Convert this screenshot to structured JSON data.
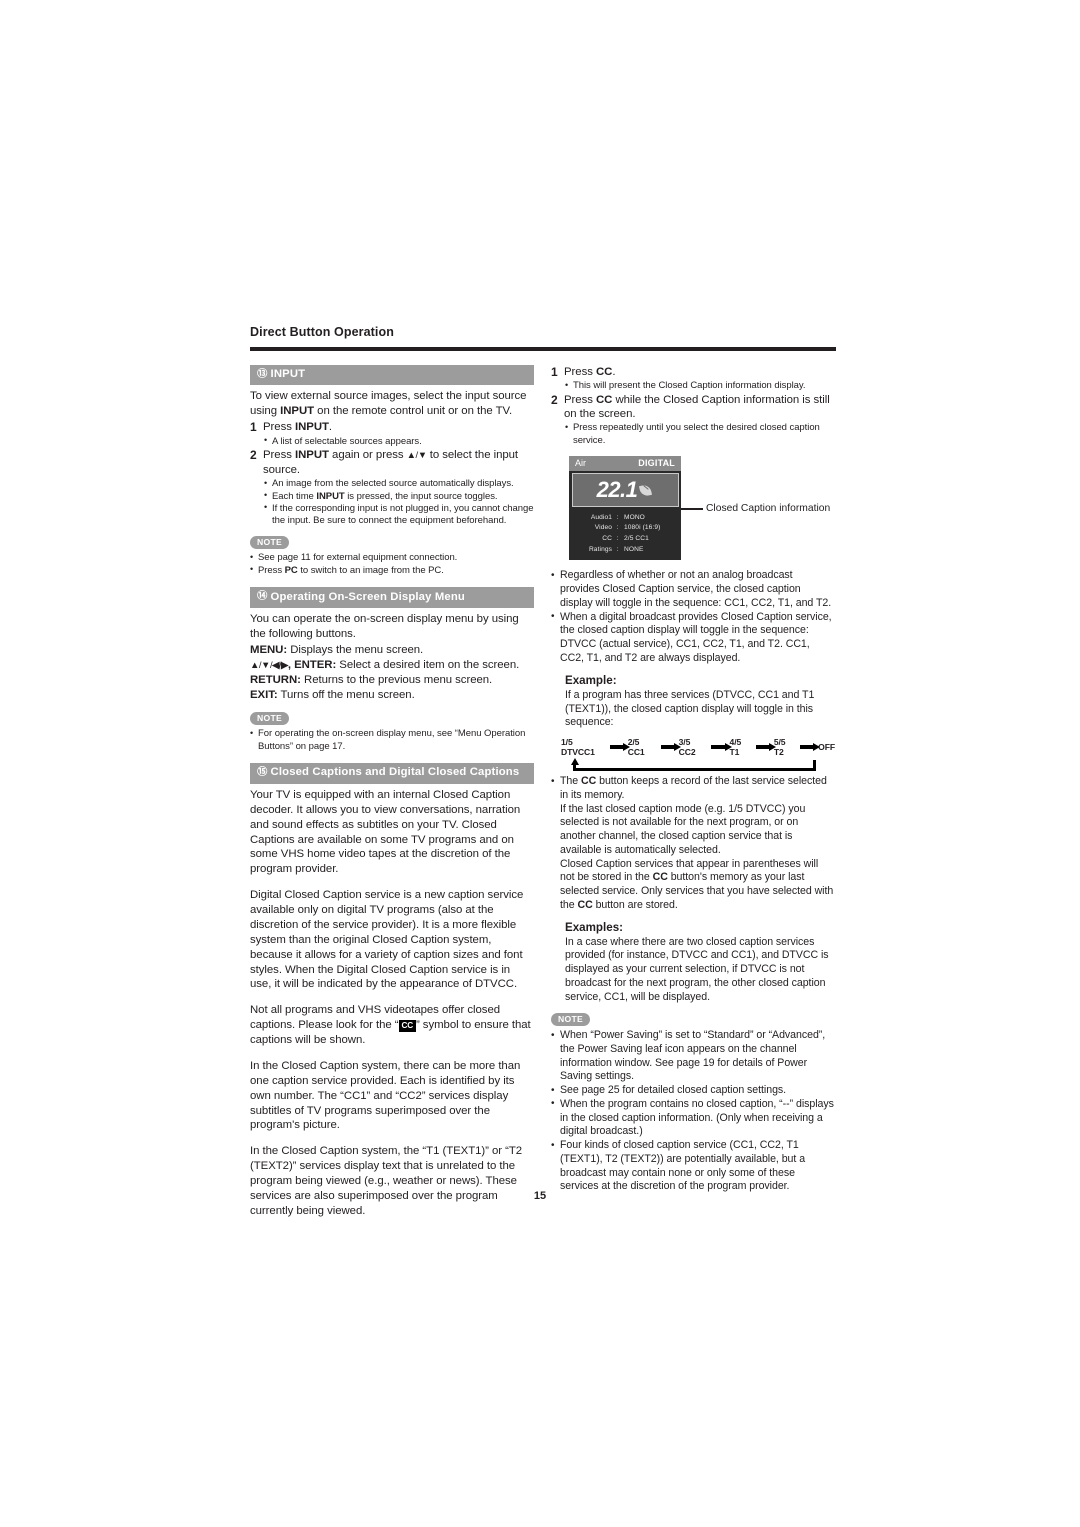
{
  "running_head": "Direct Button Operation",
  "page_number": "15",
  "left_column": {
    "section_input": {
      "number": "⑬",
      "title": "INPUT",
      "intro": "To view external source images, select the input source using <b>INPUT</b> on the remote control unit or on the TV.",
      "steps": [
        {
          "num": "1",
          "text": "Press <b>INPUT</b>.",
          "bullets": [
            "A list of selectable sources appears."
          ]
        },
        {
          "num": "2",
          "text": "Press <b>INPUT</b> again or press <span class=\"arrowglyph\"><b>▲</b>/<b>▼</b></span> to select the input source.",
          "bullets": [
            "An image from the selected source automatically displays.",
            "Each time <b>INPUT</b> is pressed, the input source toggles.",
            "If the corresponding input is not plugged in, you cannot change the input. Be sure to connect the equipment beforehand."
          ]
        }
      ],
      "note_label": "NOTE",
      "notes": [
        "See page 11 for external equipment connection.",
        "Press <b>PC</b> to switch to an image from the PC."
      ]
    },
    "section_osd": {
      "number": "⑭",
      "title": "Operating On-Screen Display Menu",
      "intro": "You can operate the on-screen display menu by using the following buttons.",
      "keys": [
        "<b>MENU:</b> Displays the menu screen.",
        "<span class=\"arrowglyph\"><b>▲</b>/<b>▼</b>/<b>◀</b>/<b>▶</b></span><b>, ENTER:</b> Select a desired item on the screen.",
        "<b>RETURN:</b> Returns to the previous menu screen.",
        "<b>EXIT:</b> Turns off the menu screen."
      ],
      "note_label": "NOTE",
      "notes": [
        "For operating the on-screen display menu, see “Menu Operation Buttons” on page 17."
      ]
    },
    "section_cc": {
      "number": "⑮",
      "title": "Closed Captions and Digital Closed Captions",
      "paragraphs": [
        "Your TV is equipped with an internal Closed Caption decoder. It allows you to view conversations, narration and sound effects as subtitles on your TV. Closed Captions are available on some TV programs and on some VHS home video tapes at the discretion of the program provider.",
        "Digital Closed Caption service is a new caption service available only on digital TV programs (also at the discretion of the service provider). It is a more flexible system than the original Closed Caption system, because it allows for a variety of caption sizes and font styles. When the Digital Closed Caption service is in use, it will be indicated by the appearance of DTVCC.",
        "Not all programs and VHS videotapes offer closed captions. Please look for the “<span class=\"ccsym\">CC</span>” symbol to ensure that captions will be shown.",
        "In the Closed Caption system, there can be more than one caption service provided.  Each is identified by its own number. The “CC1” and “CC2” services display subtitles of TV programs superimposed over the program's picture.",
        "In the Closed Caption system, the “T1 (TEXT1)” or “T2 (TEXT2)” services display text that is unrelated to the program being viewed (e.g., weather or news). These services are also superimposed over the program currently being viewed."
      ]
    }
  },
  "right_column": {
    "steps": [
      {
        "num": "1",
        "text": "Press <b>CC</b>.",
        "bullets": [
          "This will present the Closed Caption information display."
        ]
      },
      {
        "num": "2",
        "text": "Press <b>CC</b> while the Closed Caption information is still on the screen.",
        "bullets": [
          "Press repeatedly until you select the desired closed caption service."
        ]
      }
    ],
    "osd": {
      "source_label": "Air",
      "signal_label": "DIGITAL",
      "channel": "22.1",
      "leaf_icon": "power-saving-leaf-icon",
      "rows": [
        {
          "label": "Audio1",
          "sep": ":",
          "value": "MONO"
        },
        {
          "label": "Video",
          "sep": ":",
          "value": "1080i (16:9)"
        },
        {
          "label": "CC",
          "sep": ":",
          "value": "2/5 CC1"
        },
        {
          "label": "Ratings",
          "sep": ":",
          "value": "NONE"
        }
      ],
      "callout": "Closed Caption information"
    },
    "bullets_after_osd": [
      "Regardless of whether or not an analog broadcast provides Closed Caption service, the closed caption display will toggle in the sequence: CC1, CC2, T1, and T2.",
      "When a digital broadcast provides Closed Caption service, the closed caption display will toggle in the sequence: DTVCC (actual service), CC1, CC2, T1, and T2. CC1, CC2, T1, and T2 are always displayed."
    ],
    "example": {
      "heading": "Example:",
      "text": "If a program has three services (DTVCC, CC1 and T1 (TEXT1)), the closed caption display will toggle in this sequence:"
    },
    "sequence": {
      "items": [
        "1/5 DTVCC1",
        "2/5 CC1",
        "3/5 CC2",
        "4/5 T1",
        "5/5 T2",
        "OFF"
      ]
    },
    "cc_memory_bullets": [
      "The <b>CC</b> button keeps a record of the last service selected in its memory.<br>If the last closed caption mode (e.g. 1/5 DTVCC) you selected is not available for the next program, or on another channel, the closed caption service that is available is automatically selected.<br>Closed Caption services that appear in parentheses will not be stored in the <b>CC</b> button's memory as your last selected service.  Only services that you have selected with the <b>CC</b> button are stored."
    ],
    "examples": {
      "heading": "Examples:",
      "text": "In a case where there are two closed caption services provided (for instance, DTVCC and CC1), and DTVCC is displayed as your current selection, if DTVCC is not broadcast for the next program, the other closed caption service, CC1, will be displayed."
    },
    "note_label": "NOTE",
    "notes": [
      "When “Power Saving” is set to “Standard” or “Advanced”, the Power Saving leaf icon appears on the channel information window. See page 19 for details of Power Saving settings.",
      "See page 25 for detailed closed caption settings.",
      "When the program contains no closed caption, “--” displays in the closed caption information. (Only when receiving a digital broadcast.)",
      "Four kinds of closed caption service (CC1, CC2, T1 (TEXT1), T2 (TEXT2)) are potentially available, but a broadcast may contain none or only some of these services at the discretion of the program provider."
    ]
  },
  "colors": {
    "section_bar": "#9c9c9c",
    "text": "#231f20",
    "osd_header": "#8a8a8a",
    "osd_body": "#2a2a2a"
  }
}
